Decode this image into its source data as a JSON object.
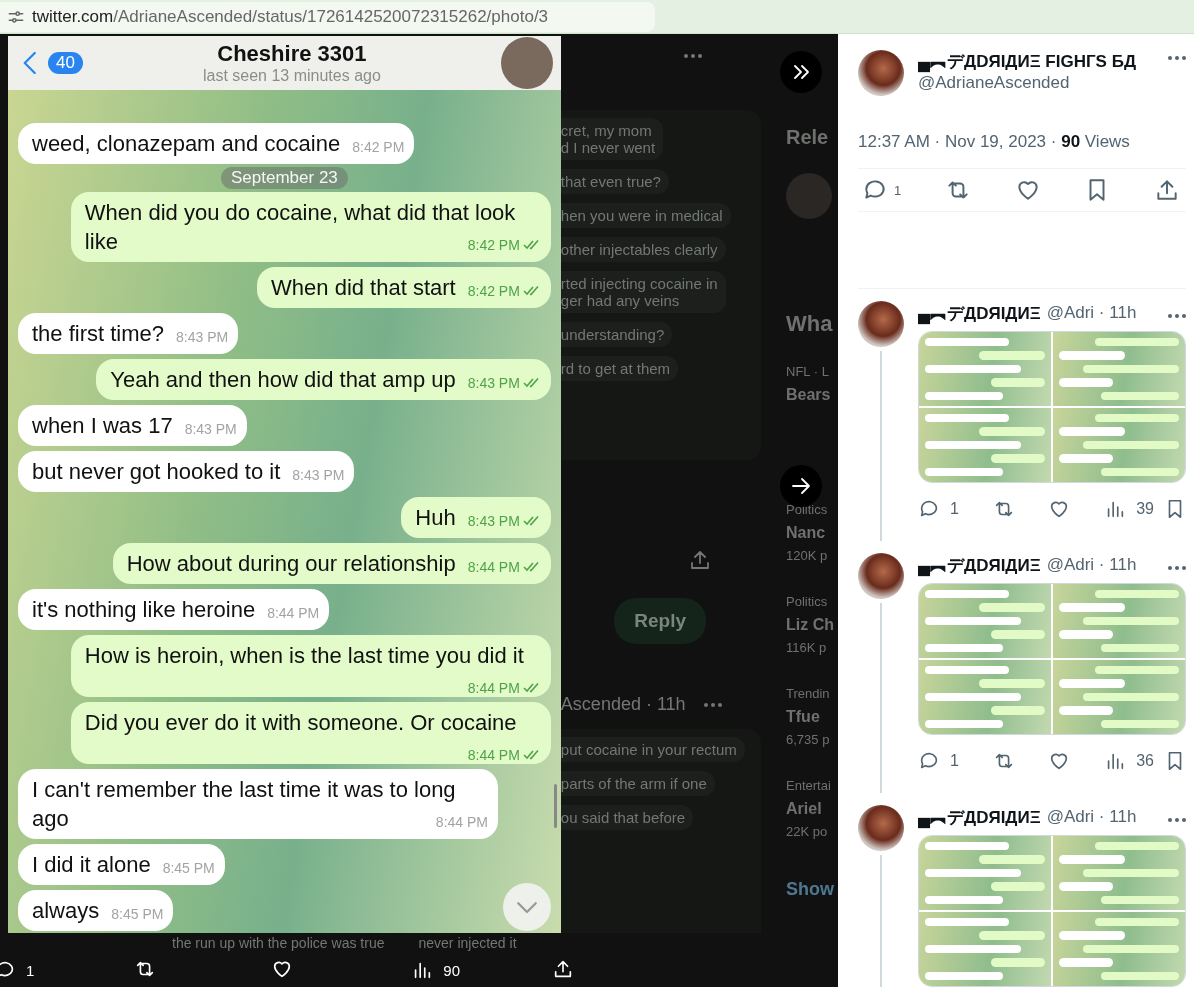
{
  "address_bar": {
    "host": "twitter.com",
    "path": "/AdrianeAscended/status/1726142520072315262/photo/3"
  },
  "photo": {
    "header": {
      "back_count": "40",
      "title": "Cheshire 3301",
      "subtitle": "last seen 13 minutes ago"
    },
    "date_pill": "September 23",
    "messages": [
      {
        "kind": "in",
        "text": "weed, clonazepam and cocaine",
        "time": "8:42 PM"
      },
      {
        "kind": "out",
        "text": "When did you do cocaine, what did that look like",
        "time": "8:42 PM",
        "read": true
      },
      {
        "kind": "out",
        "text": "When did that start",
        "time": "8:42 PM",
        "read": true
      },
      {
        "kind": "in",
        "text": "the first time?",
        "time": "8:43 PM"
      },
      {
        "kind": "out",
        "text": "Yeah and then how did that amp up",
        "time": "8:43 PM",
        "read": true
      },
      {
        "kind": "in",
        "text": "when I was 17",
        "time": "8:43 PM"
      },
      {
        "kind": "in",
        "text": "but never got hooked to it",
        "time": "8:43 PM"
      },
      {
        "kind": "out",
        "text": "Huh",
        "time": "8:43 PM",
        "read": true
      },
      {
        "kind": "out",
        "text": "How about during our relationship",
        "time": "8:44 PM",
        "read": true
      },
      {
        "kind": "in",
        "text": "it's nothing like heroine",
        "time": "8:44 PM"
      },
      {
        "kind": "out",
        "text": "How is heroin, when is the last time you did it",
        "time": "8:44 PM",
        "read": true
      },
      {
        "kind": "out",
        "text": "Did you ever do it with someone. Or cocaine",
        "time": "8:44 PM",
        "read": true
      },
      {
        "kind": "in",
        "text": "I can't remember the last time it was to long ago",
        "time": "8:44 PM"
      },
      {
        "kind": "in",
        "text": "I did it alone",
        "time": "8:45 PM"
      },
      {
        "kind": "in",
        "text": "always",
        "time": "8:45 PM"
      }
    ]
  },
  "photo_actions": {
    "replies": "1",
    "views": "90"
  },
  "background": {
    "top_bubbles": [
      [
        "cret, my mom",
        "d I never went"
      ],
      [
        "that even true?"
      ],
      [
        "hen you were in medical"
      ],
      [
        "other injectables clearly"
      ],
      [
        "rted injecting cocaine in",
        "ger had any veins"
      ],
      [
        "understanding?"
      ],
      [
        "rd to get at them"
      ]
    ],
    "reply_button": "Reply",
    "thread_meta": "Ascended · 11h",
    "lower_bubbles": [
      [
        "put cocaine in your rectum"
      ],
      [
        "parts of the arm if one"
      ],
      [
        "ou said that before"
      ]
    ],
    "under_bar_texts": [
      "the run up with the police was true",
      "never injected it"
    ]
  },
  "dim_sidebar": [
    {
      "kind": "heading",
      "text": "Rele"
    },
    {
      "kind": "avatar"
    },
    {
      "kind": "heading2",
      "text": "Wha"
    },
    {
      "kind": "category",
      "text": "NFL · L"
    },
    {
      "kind": "title",
      "text": "Bears"
    },
    {
      "kind": "category2",
      "text": "Politics"
    },
    {
      "kind": "title",
      "text": "Nanc"
    },
    {
      "kind": "count",
      "text": "120K p"
    },
    {
      "kind": "category",
      "text": "Politics"
    },
    {
      "kind": "title",
      "text": "Liz Ch"
    },
    {
      "kind": "count",
      "text": "116K p"
    },
    {
      "kind": "category",
      "text": "Trendin"
    },
    {
      "kind": "title",
      "text": "Tfue"
    },
    {
      "kind": "count",
      "text": "6,735 p"
    },
    {
      "kind": "category",
      "text": "Entertai"
    },
    {
      "kind": "title",
      "text": "Ariel"
    },
    {
      "kind": "count",
      "text": "22K po"
    },
    {
      "kind": "link",
      "text": "Show"
    }
  ],
  "tweet": {
    "name": "▄︻デДDЯIДИΞ FIGHГS БД",
    "handle": "@AdrianeAscended",
    "timestamp": "12:37 AM · Nov 19, 2023 · **90** Views",
    "replies": "1"
  },
  "replies": [
    {
      "name": "▄︻デДDЯIДИΞ",
      "meta": "@Adri · 11h",
      "replies": "1",
      "views": "39"
    },
    {
      "name": "▄︻デДDЯIДИΞ",
      "meta": "@Adri · 11h",
      "replies": "1",
      "views": "36"
    },
    {
      "name": "▄︻デДDЯIДИΞ",
      "meta": "@Adri · 11h"
    }
  ]
}
